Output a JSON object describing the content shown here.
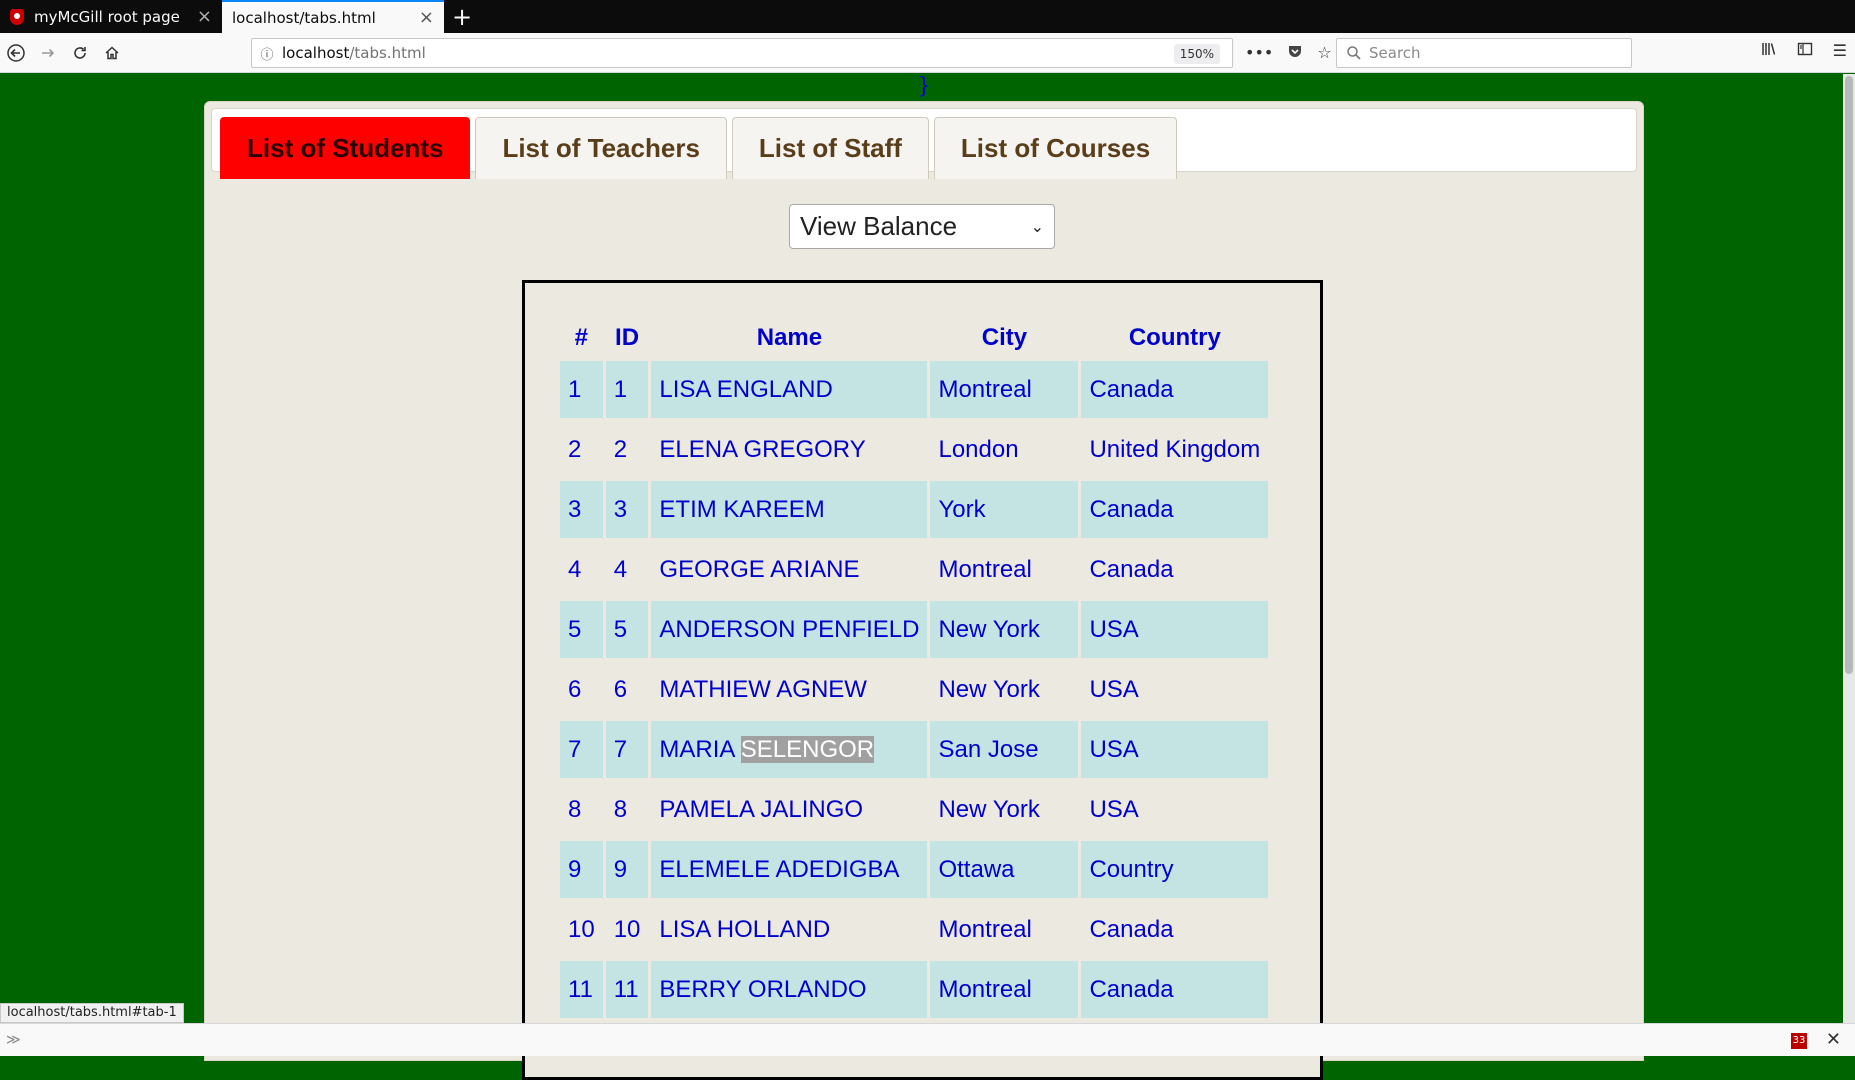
{
  "browser": {
    "tabs": [
      {
        "title": "myMcGill root page",
        "active": false
      },
      {
        "title": "localhost/tabs.html",
        "active": true
      }
    ],
    "url_host": "localhost",
    "url_path": "/tabs.html",
    "zoom": "150%",
    "search_placeholder": "Search",
    "status_url": "localhost/tabs.html#tab-1",
    "badge_count": "33"
  },
  "page": {
    "stray_text": "}",
    "tabs": [
      "List of Students",
      "List of Teachers",
      "List of Staff",
      "List of Courses"
    ],
    "active_tab": 0,
    "select_value": "View Balance",
    "table": {
      "headers": [
        "#",
        "ID",
        "Name",
        "City",
        "Country"
      ],
      "rows": [
        [
          "1",
          "1",
          "LISA ENGLAND",
          "Montreal",
          "Canada"
        ],
        [
          "2",
          "2",
          "ELENA GREGORY",
          "London",
          "United Kingdom"
        ],
        [
          "3",
          "3",
          "ETIM KAREEM",
          "York",
          "Canada"
        ],
        [
          "4",
          "4",
          "GEORGE ARIANE",
          "Montreal",
          "Canada"
        ],
        [
          "5",
          "5",
          "ANDERSON PENFIELD",
          "New York",
          "USA"
        ],
        [
          "6",
          "6",
          "MATHIEW AGNEW",
          "New York",
          "USA"
        ],
        [
          "7",
          "7",
          "MARIA SELENGOR",
          "San Jose",
          "USA"
        ],
        [
          "8",
          "8",
          "PAMELA JALINGO",
          "New York",
          "USA"
        ],
        [
          "9",
          "9",
          "ELEMELE ADEDIGBA",
          "Ottawa",
          "Country"
        ],
        [
          "10",
          "10",
          "LISA HOLLAND",
          "Montreal",
          "Canada"
        ],
        [
          "11",
          "11",
          "BERRY ORLANDO",
          "Montreal",
          "Canada"
        ]
      ],
      "highlight": {
        "row": 6,
        "text": "SELENGOR"
      }
    }
  },
  "colors": {
    "page_bg": "#006400",
    "active_tab_bg": "#ff0000",
    "link_text": "#0000cc",
    "row_stripe": "#c4e4e4"
  },
  "icons": {
    "back": "arrow-left-icon",
    "forward": "arrow-right-icon",
    "reload": "reload-icon",
    "home": "home-icon"
  }
}
